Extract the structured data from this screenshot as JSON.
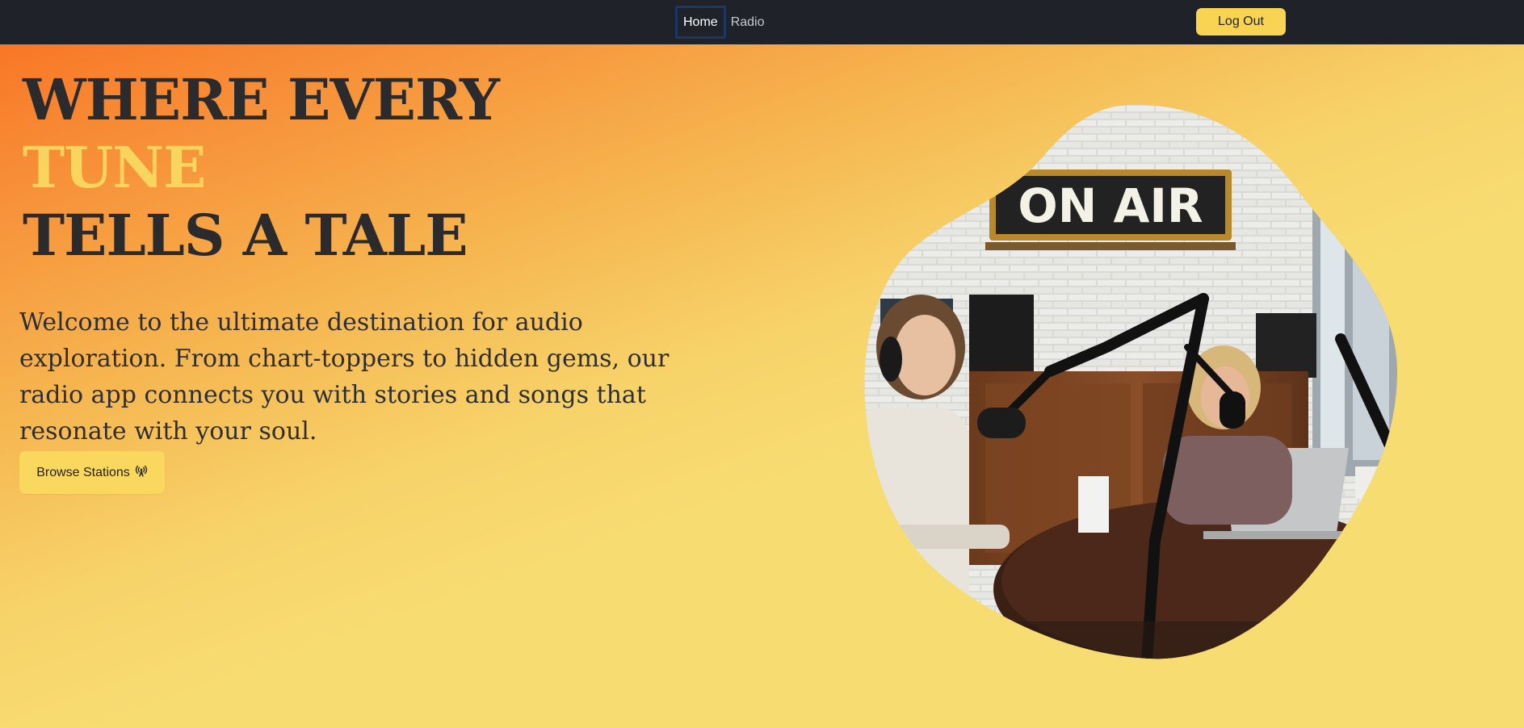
{
  "nav": {
    "links": [
      {
        "label": "Home",
        "active": true
      },
      {
        "label": "Radio",
        "active": false
      }
    ],
    "logout_label": "Log Out"
  },
  "hero": {
    "title_line1": "WHERE EVERY",
    "title_line2": "TUNE",
    "title_line3": "TELLS A TALE",
    "description": "Welcome to the ultimate destination for audio exploration. From chart-toppers to hidden gems, our radio app connects you with stories and songs that resonate with your soul.",
    "cta_label": "Browse Stations",
    "cta_icon": "broadcast-icon",
    "image_sign": "ON AIR"
  },
  "colors": {
    "topbar": "#1f2329",
    "accent_yellow": "#f8d452",
    "gradient_start": "#f86f22",
    "gradient_end": "#f7dc72",
    "title_text": "#2b2b2e"
  }
}
